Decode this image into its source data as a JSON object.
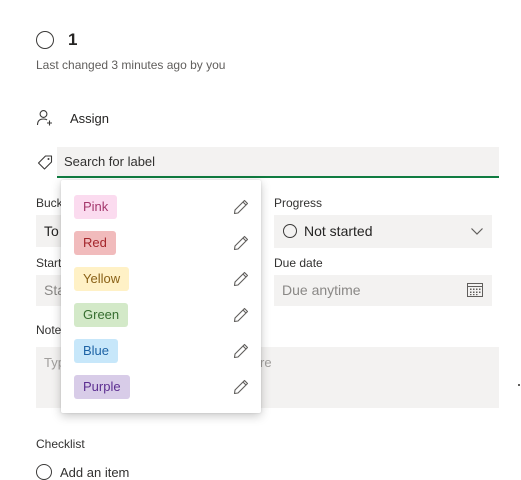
{
  "task": {
    "title": "1",
    "last_changed": "Last changed 3 minutes ago by you"
  },
  "assign": {
    "label": "Assign",
    "icon": "person-add-icon"
  },
  "label_search": {
    "placeholder": "Search for label",
    "icon": "tag-icon"
  },
  "fields": {
    "bucket_label": "Buck",
    "bucket_value": "To",
    "progress_label": "Progress",
    "progress_value": "Not started",
    "start_label": "Start",
    "start_placeholder": "Sta",
    "due_label": "Due date",
    "due_placeholder": "Due anytime",
    "notes_label": "Note",
    "notes_placeholder_left": "Typ",
    "notes_placeholder_right": "re",
    "checklist_label": "Checklist",
    "add_item": "Add an item"
  },
  "labels": [
    {
      "name": "Pink",
      "bg": "#fbdbef",
      "fg": "#a4376c"
    },
    {
      "name": "Red",
      "bg": "#f1bbbc",
      "fg": "#a4262c"
    },
    {
      "name": "Yellow",
      "bg": "#fff1c6",
      "fg": "#8a6116"
    },
    {
      "name": "Green",
      "bg": "#d3e9c8",
      "fg": "#376e30"
    },
    {
      "name": "Blue",
      "bg": "#c7e7fa",
      "fg": "#1d63a5"
    },
    {
      "name": "Purple",
      "bg": "#d8cce8",
      "fg": "#5c2e91"
    }
  ],
  "colors": {
    "accent": "#107c41"
  }
}
